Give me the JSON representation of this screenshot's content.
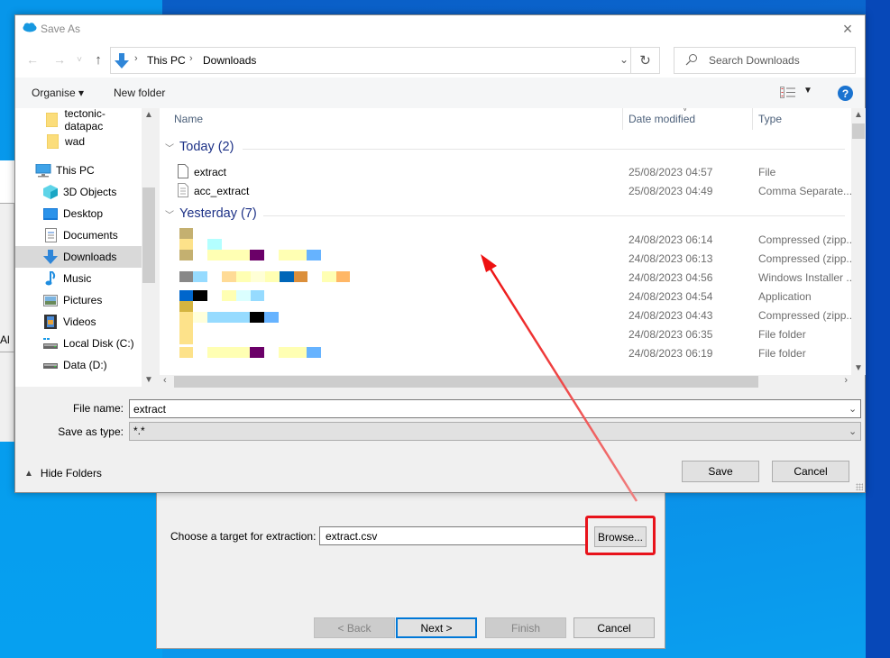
{
  "dialog": {
    "title": "Save As",
    "close_label": "×"
  },
  "navigation": {
    "back_icon": "←",
    "forward_icon": "→",
    "recent_icon": "˅",
    "up_icon": "↑",
    "breadcrumb": [
      "This PC",
      "Downloads"
    ],
    "breadcrumb_separator": "›",
    "dropdown_icon": "⌄",
    "refresh_icon": "↻",
    "search_placeholder": "Search Downloads"
  },
  "toolbar": {
    "organise_label": "Organise ▾",
    "new_folder_label": "New folder",
    "view_dropdown": "▼",
    "help_label": "?"
  },
  "nav_pane": {
    "items": [
      {
        "label": "tectonic-datapac",
        "icon": "folder-icon",
        "selected": false
      },
      {
        "label": "wad",
        "icon": "folder-icon",
        "selected": false
      },
      {
        "label": "This PC",
        "icon": "computer-icon",
        "selected": false
      },
      {
        "label": "3D Objects",
        "icon": "3d-objects-icon",
        "selected": false
      },
      {
        "label": "Desktop",
        "icon": "desktop-icon",
        "selected": false
      },
      {
        "label": "Documents",
        "icon": "documents-icon",
        "selected": false
      },
      {
        "label": "Downloads",
        "icon": "downloads-icon",
        "selected": true
      },
      {
        "label": "Music",
        "icon": "music-icon",
        "selected": false
      },
      {
        "label": "Pictures",
        "icon": "pictures-icon",
        "selected": false
      },
      {
        "label": "Videos",
        "icon": "videos-icon",
        "selected": false
      },
      {
        "label": "Local Disk (C:)",
        "icon": "local-disk-icon",
        "selected": false
      },
      {
        "label": "Data (D:)",
        "icon": "drive-icon",
        "selected": false
      }
    ]
  },
  "file_list": {
    "columns": {
      "name": "Name",
      "date_modified": "Date modified",
      "type": "Type"
    },
    "groups": [
      {
        "label": "Today (2)",
        "rows": [
          {
            "name": "extract",
            "date": "25/08/2023 04:57",
            "type": "File",
            "icon": "file-icon"
          },
          {
            "name": "acc_extract",
            "date": "25/08/2023 04:49",
            "type": "Comma Separate...",
            "icon": "csv-file-icon"
          }
        ]
      },
      {
        "label": "Yesterday (7)",
        "rows": [
          {
            "name": "",
            "date": "24/08/2023 06:14",
            "type": "Compressed (zipp..."
          },
          {
            "name": "",
            "date": "24/08/2023 06:13",
            "type": "Compressed (zipp..."
          },
          {
            "name": "",
            "date": "24/08/2023 04:56",
            "type": "Windows Installer ..."
          },
          {
            "name": "",
            "date": "24/08/2023 04:54",
            "type": "Application"
          },
          {
            "name": "",
            "date": "24/08/2023 04:43",
            "type": "Compressed (zipp..."
          },
          {
            "name": "",
            "date": "24/08/2023 06:35",
            "type": "File folder"
          },
          {
            "name": "",
            "date": "24/08/2023 06:19",
            "type": "File folder"
          }
        ]
      }
    ]
  },
  "form": {
    "file_name_label": "File name:",
    "file_name_value": "extract",
    "save_as_type_label": "Save as type:",
    "save_as_type_value": "*.*",
    "hide_folders_label": "Hide Folders",
    "save_label": "Save",
    "cancel_label": "Cancel"
  },
  "wizard": {
    "target_label": "Choose a target for extraction:",
    "target_value": "extract.csv",
    "browse_label": "Browse...",
    "back_label": "< Back",
    "next_label": "Next >",
    "finish_label": "Finish",
    "cancel_label": "Cancel"
  },
  "background_window": {
    "partial_text": "t Al"
  },
  "colors": {
    "accent": "#0078d7",
    "highlight": "#e8131b",
    "group_header": "#1e3287"
  }
}
